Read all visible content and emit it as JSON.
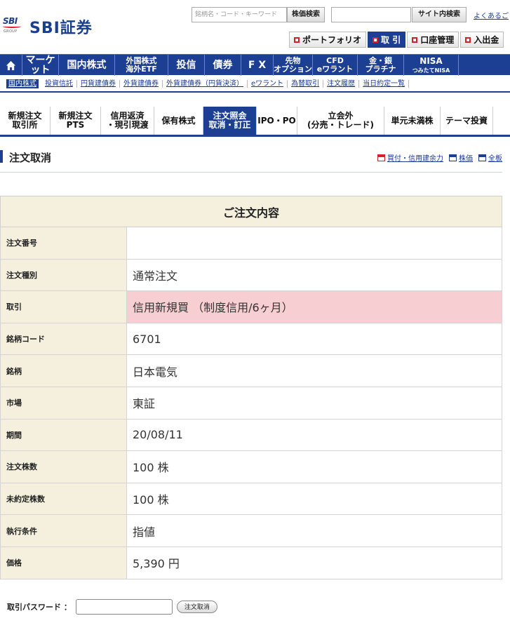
{
  "header": {
    "logo_text": "SBI証券",
    "logo_mark": "SBI",
    "logo_group": "GROUP",
    "search_placeholder": "銘柄名・コード・キーワード",
    "search_button": "株価検索",
    "site_search_button": "サイト内検索",
    "faq_link": "よくあるご",
    "topnav": [
      {
        "label": "ポートフォリオ",
        "active": false
      },
      {
        "label": "取 引",
        "active": true
      },
      {
        "label": "口座管理",
        "active": false
      },
      {
        "label": "入出金",
        "active": false
      }
    ]
  },
  "mainnav": {
    "items": [
      {
        "line1": "マーケット",
        "line2": ""
      },
      {
        "line1": "国内株式",
        "line2": ""
      },
      {
        "line1": "外国株式",
        "line2": "海外ETF"
      },
      {
        "line1": "投信",
        "line2": ""
      },
      {
        "line1": "債券",
        "line2": ""
      },
      {
        "line1": "F X",
        "line2": ""
      },
      {
        "line1": "先物",
        "line2": "オプション"
      },
      {
        "line1": "CFD",
        "line2": "eワラント"
      },
      {
        "line1": "金・銀",
        "line2": "プラチナ"
      },
      {
        "line1": "NISA",
        "line2": "つみたてNISA"
      }
    ]
  },
  "subnav": {
    "items": [
      {
        "label": "国内株式",
        "active": true
      },
      {
        "label": "投資信託",
        "active": false
      },
      {
        "label": "円貨建債券",
        "active": false
      },
      {
        "label": "外貨建債券",
        "active": false
      },
      {
        "label": "外貨建債券（円貨決済）",
        "active": false
      },
      {
        "label": "eワラント",
        "active": false
      },
      {
        "label": "為替取引",
        "active": false
      },
      {
        "label": "注文履歴",
        "active": false
      },
      {
        "label": "当日約定一覧",
        "active": false
      }
    ]
  },
  "tabs": [
    {
      "line1": "新規注文",
      "line2": "取引所",
      "active": false
    },
    {
      "line1": "新規注文",
      "line2": "PTS",
      "active": false
    },
    {
      "line1": "信用返済",
      "line2": "・現引現渡",
      "active": false
    },
    {
      "line1": "保有株式",
      "line2": "",
      "active": false
    },
    {
      "line1": "注文照会",
      "line2": "取消・訂正",
      "active": true
    },
    {
      "line1": "IPO・PO",
      "line2": "",
      "active": false
    },
    {
      "line1": "立会外",
      "line2": "(分売・トレード)",
      "active": false
    },
    {
      "line1": "単元未満株",
      "line2": "",
      "active": false
    },
    {
      "line1": "テーマ投資",
      "line2": "",
      "active": false
    }
  ],
  "page": {
    "title": "注文取消",
    "links": [
      {
        "label": "買付・信用建余力",
        "icon": "window-red-icon"
      },
      {
        "label": "株価",
        "icon": "window-icon"
      },
      {
        "label": "全板",
        "icon": "window-icon"
      }
    ]
  },
  "order": {
    "caption": "ご注文内容",
    "rows": [
      {
        "label": "注文番号",
        "value": "",
        "highlight": false
      },
      {
        "label": "注文種別",
        "value": "通常注文",
        "highlight": false
      },
      {
        "label": "取引",
        "value": "信用新規買 （制度信用/6ヶ月）",
        "highlight": true
      },
      {
        "label": "銘柄コード",
        "value": "6701",
        "highlight": false
      },
      {
        "label": "銘柄",
        "value": "日本電気",
        "highlight": false
      },
      {
        "label": "市場",
        "value": "東証",
        "highlight": false
      },
      {
        "label": "期間",
        "value": "20/08/11",
        "highlight": false
      },
      {
        "label": "注文株数",
        "value": "100 株",
        "highlight": false
      },
      {
        "label": "未約定株数",
        "value": "100 株",
        "highlight": false
      },
      {
        "label": "執行条件",
        "value": "指値",
        "highlight": false
      },
      {
        "label": "価格",
        "value": "5,390 円",
        "highlight": false
      }
    ]
  },
  "password": {
    "label": "取引パスワード ：",
    "value": "",
    "button": "注文取消"
  },
  "colors": {
    "brand_blue": "#1c3f94",
    "accent_red": "#d7202a",
    "label_bg": "#f5f0dd",
    "highlight_bg": "#f7cfd2"
  }
}
